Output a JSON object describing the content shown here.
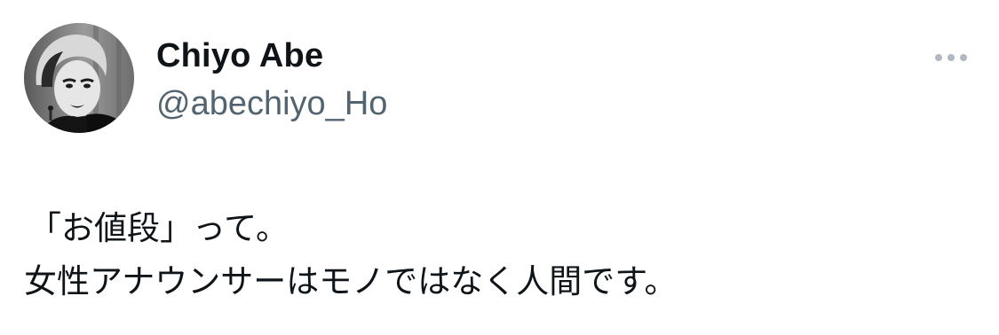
{
  "author": {
    "display_name": "Chiyo Abe",
    "handle": "@abechiyo_Ho",
    "avatar_icon": "profile-photo-avatar"
  },
  "menu": {
    "icon": "more-horizontal-icon"
  },
  "tweet": {
    "lines": [
      "「お値段」って。",
      "女性アナウンサーはモノではなく人間です。"
    ]
  },
  "colors": {
    "name": "#0f1419",
    "handle": "#536471",
    "more_dots": "#b0b8c1",
    "background": "#ffffff"
  }
}
